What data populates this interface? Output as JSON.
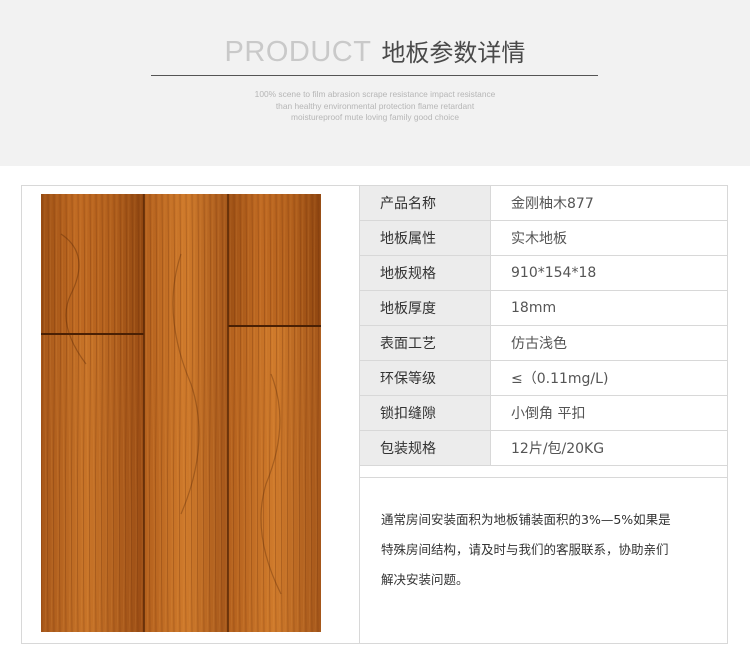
{
  "header": {
    "title_en": "PRODUCT",
    "title_zh": "地板参数详情",
    "subtitle_lines": [
      "100% scene to film abrasion scrape resistance impact resistance",
      "than healthy environmental protection flame retardant",
      "moistureproof mute loving family good choice"
    ]
  },
  "colors": {
    "banner_bg": "#f2f2f2",
    "label_bg": "#ececec",
    "border": "#d8d8d8",
    "wood_base": "#a75818"
  },
  "specs": [
    {
      "label": "产品名称",
      "value": "金刚柚木877"
    },
    {
      "label": "地板属性",
      "value": "实木地板"
    },
    {
      "label": "地板规格",
      "value": "910*154*18"
    },
    {
      "label": "地板厚度",
      "value": "18mm"
    },
    {
      "label": "表面工艺",
      "value": "仿古浅色"
    },
    {
      "label": "环保等级",
      "value": "≤（0.11mg/L)"
    },
    {
      "label": "锁扣缝隙",
      "value": "小倒角 平扣"
    },
    {
      "label": "包装规格",
      "value": "12片/包/20KG"
    }
  ],
  "note_lines": [
    "通常房间安装面积为地板铺装面积的3%—5%如果是",
    "特殊房间结构，请及时与我们的客服联系，协助亲们",
    "解决安装问题。"
  ]
}
